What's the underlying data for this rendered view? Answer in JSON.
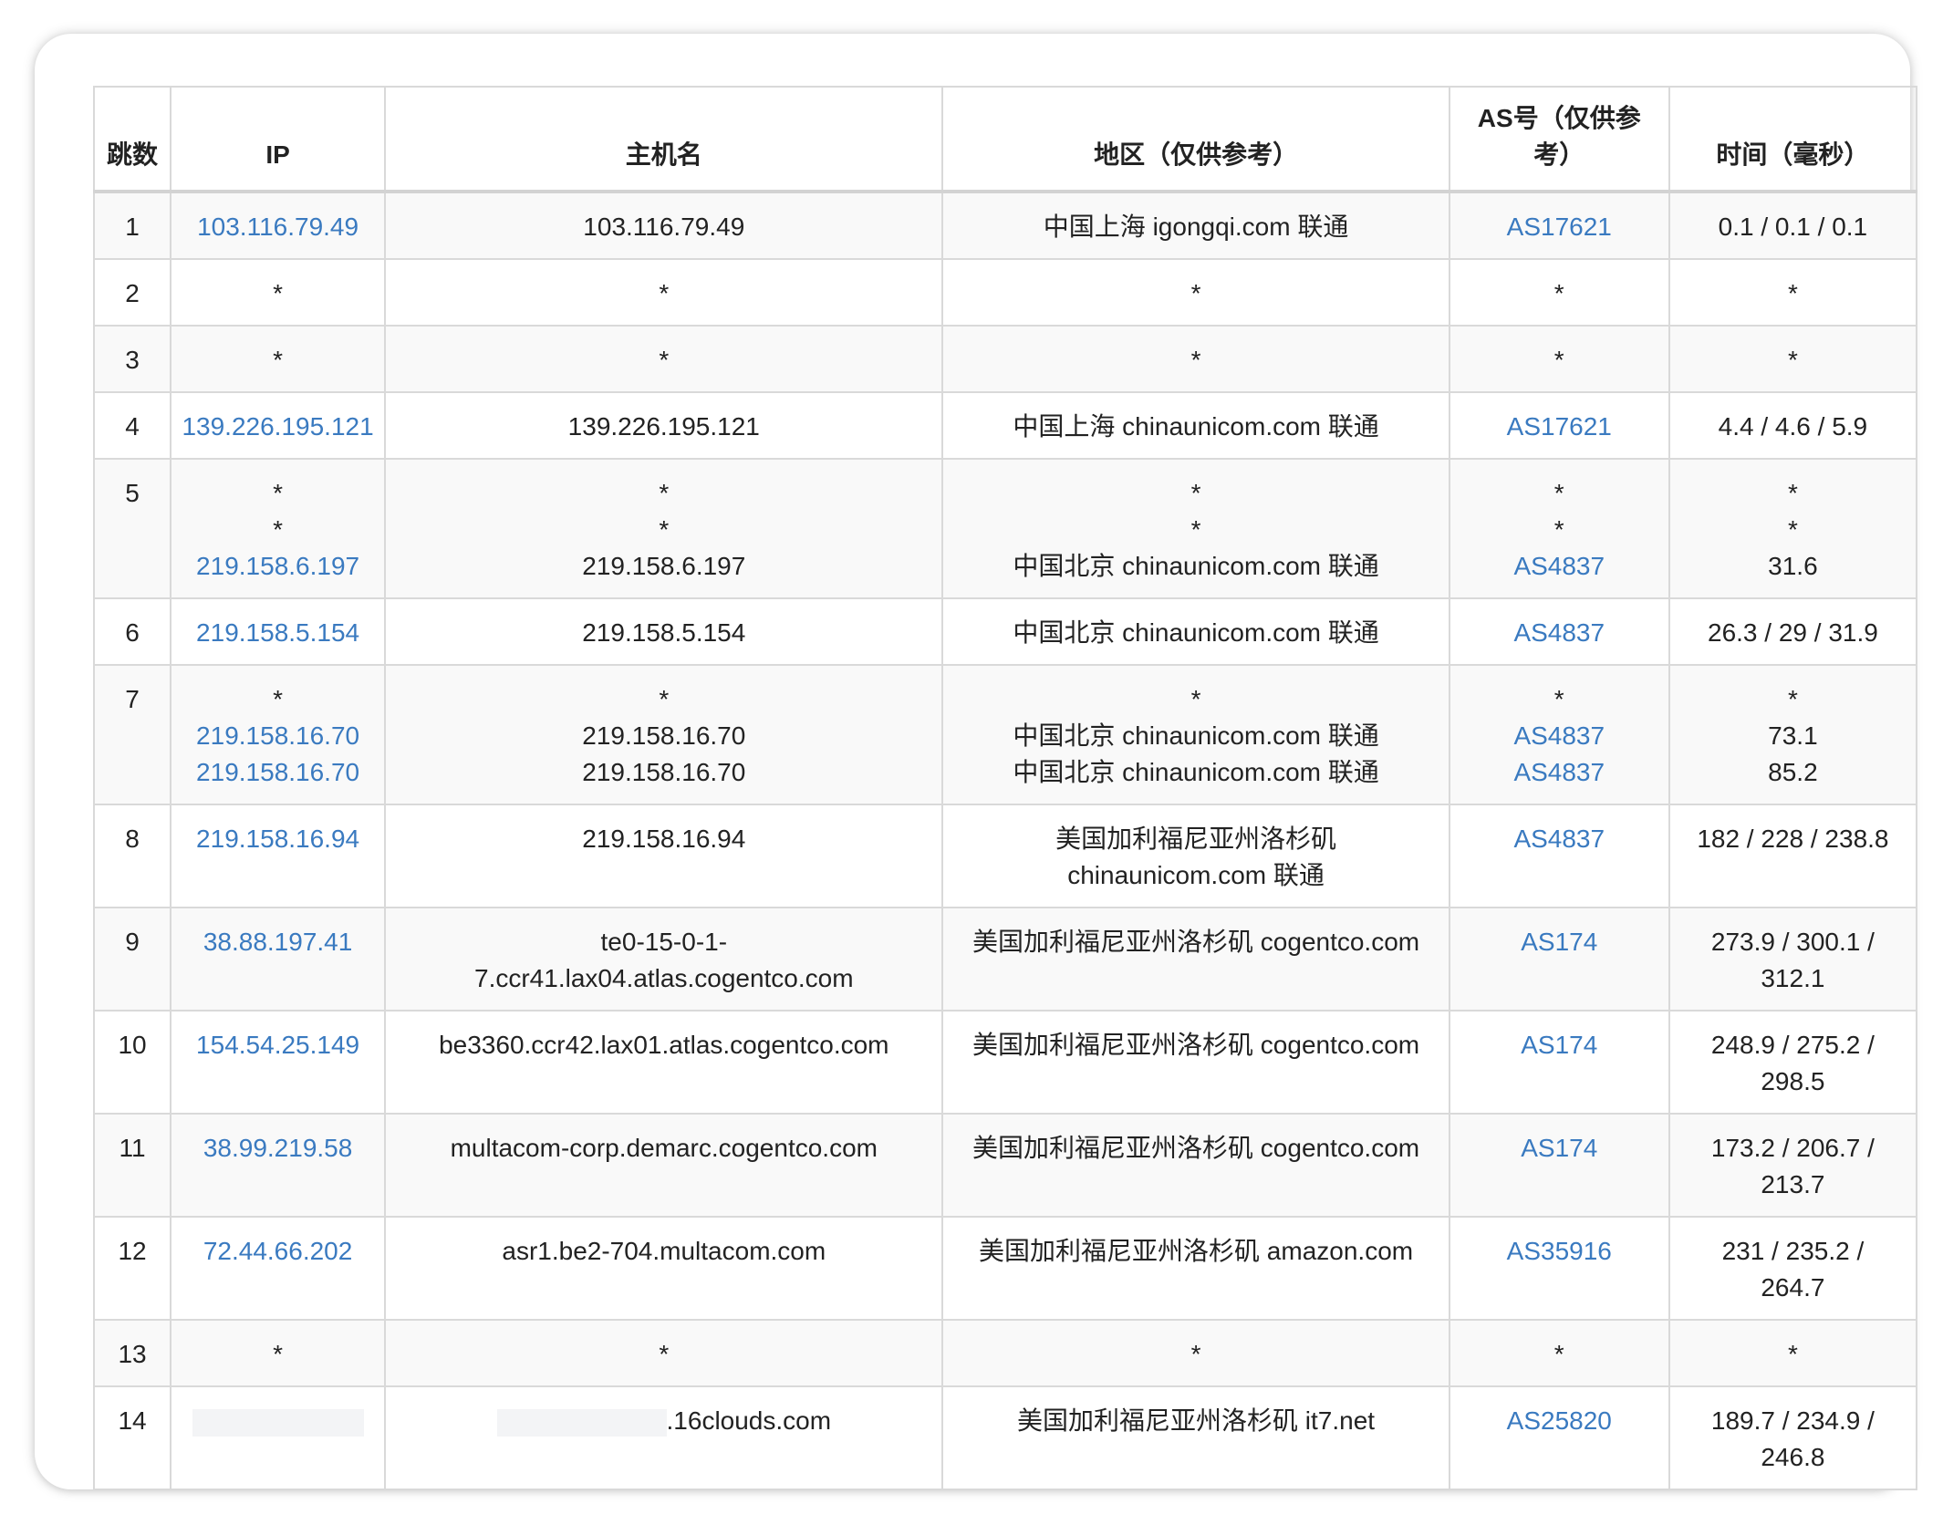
{
  "table": {
    "headers": [
      "跳数",
      "IP",
      "主机名",
      "地区（仅供参考）",
      "AS号（仅供参考）",
      "时间（毫秒）"
    ],
    "rows": [
      {
        "hop": "1",
        "ip": [
          "103.116.79.49"
        ],
        "host": [
          "103.116.79.49"
        ],
        "region": [
          "中国上海 igongqi.com 联通"
        ],
        "asn": [
          "AS17621"
        ],
        "time": [
          "0.1 / 0.1 / 0.1"
        ]
      },
      {
        "hop": "2",
        "ip": [
          "*"
        ],
        "host": [
          "*"
        ],
        "region": [
          "*"
        ],
        "asn": [
          "*"
        ],
        "time": [
          "*"
        ]
      },
      {
        "hop": "3",
        "ip": [
          "*"
        ],
        "host": [
          "*"
        ],
        "region": [
          "*"
        ],
        "asn": [
          "*"
        ],
        "time": [
          "*"
        ]
      },
      {
        "hop": "4",
        "ip": [
          "139.226.195.121"
        ],
        "host": [
          "139.226.195.121"
        ],
        "region": [
          "中国上海 chinaunicom.com 联通"
        ],
        "asn": [
          "AS17621"
        ],
        "time": [
          "4.4 / 4.6 / 5.9"
        ]
      },
      {
        "hop": "5",
        "ip": [
          "*",
          "*",
          "219.158.6.197"
        ],
        "host": [
          "*",
          "*",
          "219.158.6.197"
        ],
        "region": [
          "*",
          "*",
          "中国北京 chinaunicom.com 联通"
        ],
        "asn": [
          "*",
          "*",
          "AS4837"
        ],
        "time": [
          "*",
          "*",
          "31.6"
        ]
      },
      {
        "hop": "6",
        "ip": [
          "219.158.5.154"
        ],
        "host": [
          "219.158.5.154"
        ],
        "region": [
          "中国北京 chinaunicom.com 联通"
        ],
        "asn": [
          "AS4837"
        ],
        "time": [
          "26.3 / 29 / 31.9"
        ]
      },
      {
        "hop": "7",
        "ip": [
          "*",
          "219.158.16.70",
          "219.158.16.70"
        ],
        "host": [
          "*",
          "219.158.16.70",
          "219.158.16.70"
        ],
        "region": [
          "*",
          "中国北京 chinaunicom.com 联通",
          "中国北京 chinaunicom.com 联通"
        ],
        "asn": [
          "*",
          "AS4837",
          "AS4837"
        ],
        "time": [
          "*",
          "73.1",
          "85.2"
        ]
      },
      {
        "hop": "8",
        "ip": [
          "219.158.16.94"
        ],
        "host": [
          "219.158.16.94"
        ],
        "region": [
          "美国加利福尼亚州洛杉矶",
          "chinaunicom.com 联通"
        ],
        "asn": [
          "AS4837"
        ],
        "time": [
          "182 / 228 / 238.8"
        ]
      },
      {
        "hop": "9",
        "ip": [
          "38.88.197.41"
        ],
        "host": [
          "te0-15-0-1-",
          "7.ccr41.lax04.atlas.cogentco.com"
        ],
        "region": [
          "美国加利福尼亚州洛杉矶 cogentco.com"
        ],
        "asn": [
          "AS174"
        ],
        "time": [
          "273.9 / 300.1 /",
          "312.1"
        ]
      },
      {
        "hop": "10",
        "ip": [
          "154.54.25.149"
        ],
        "host": [
          "be3360.ccr42.lax01.atlas.cogentco.com"
        ],
        "region": [
          "美国加利福尼亚州洛杉矶 cogentco.com"
        ],
        "asn": [
          "AS174"
        ],
        "time": [
          "248.9 / 275.2 /",
          "298.5"
        ]
      },
      {
        "hop": "11",
        "ip": [
          "38.99.219.58"
        ],
        "host": [
          "multacom-corp.demarc.cogentco.com"
        ],
        "region": [
          "美国加利福尼亚州洛杉矶 cogentco.com"
        ],
        "asn": [
          "AS174"
        ],
        "time": [
          "173.2 / 206.7 /",
          "213.7"
        ]
      },
      {
        "hop": "12",
        "ip": [
          "72.44.66.202"
        ],
        "host": [
          "asr1.be2-704.multacom.com"
        ],
        "region": [
          "美国加利福尼亚州洛杉矶 amazon.com"
        ],
        "asn": [
          "AS35916"
        ],
        "time": [
          "231 / 235.2 /",
          "264.7"
        ]
      },
      {
        "hop": "13",
        "ip": [
          "*"
        ],
        "host": [
          "*"
        ],
        "region": [
          "*"
        ],
        "asn": [
          "*"
        ],
        "time": [
          "*"
        ]
      },
      {
        "hop": "14",
        "ip": [],
        "host_suffix": ".16clouds.com",
        "region": [
          "美国加利福尼亚州洛杉矶 it7.net"
        ],
        "asn": [
          "AS25820"
        ],
        "time": [
          "189.7 / 234.9 /",
          "246.8"
        ]
      }
    ]
  },
  "colors": {
    "link": "#3a7ac0",
    "border": "#d9d9d9",
    "stripe": "#f9f9f9",
    "redaction": "#f3f4f6"
  }
}
